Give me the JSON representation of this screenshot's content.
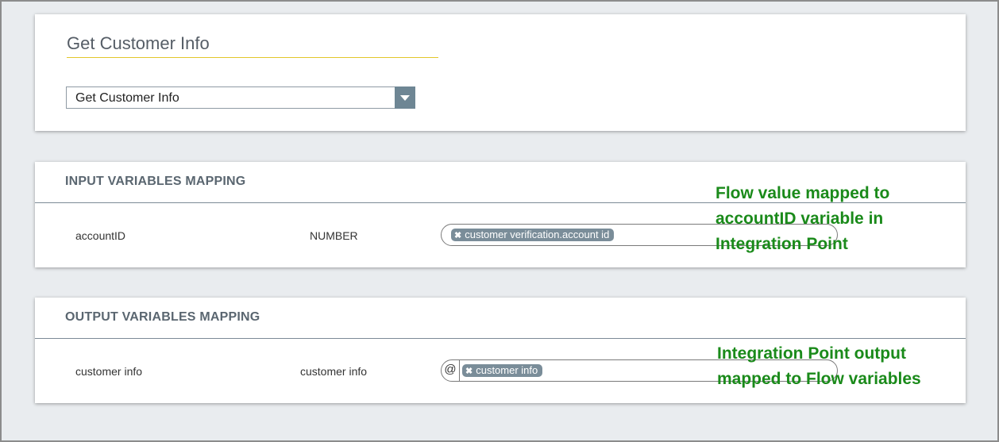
{
  "integration": {
    "title": "Get Customer Info",
    "selected_value": "Get Customer Info"
  },
  "input_mapping": {
    "header": "INPUT VARIABLES MAPPING",
    "rows": [
      {
        "variable": "accountID",
        "type": "NUMBER",
        "mapped_value": "customer verification.account id"
      }
    ],
    "annotation_lines": [
      "Flow value mapped to",
      "accountID variable in",
      "Integration Point"
    ]
  },
  "output_mapping": {
    "header": "OUTPUT VARIABLES MAPPING",
    "rows": [
      {
        "variable": "customer info",
        "type": "customer info",
        "at_symbol": "@",
        "mapped_value": "customer info"
      }
    ],
    "annotation_lines": [
      "Integration Point output",
      "mapped to Flow variables"
    ]
  },
  "icons": {
    "remove_tag": "close-icon",
    "dropdown": "chevron-down-icon"
  },
  "colors": {
    "tag_bg": "#7a8d99",
    "annotation": "#1a8a1a",
    "title_underline": "#e2c62a",
    "dropdown_button": "#6e8694"
  }
}
